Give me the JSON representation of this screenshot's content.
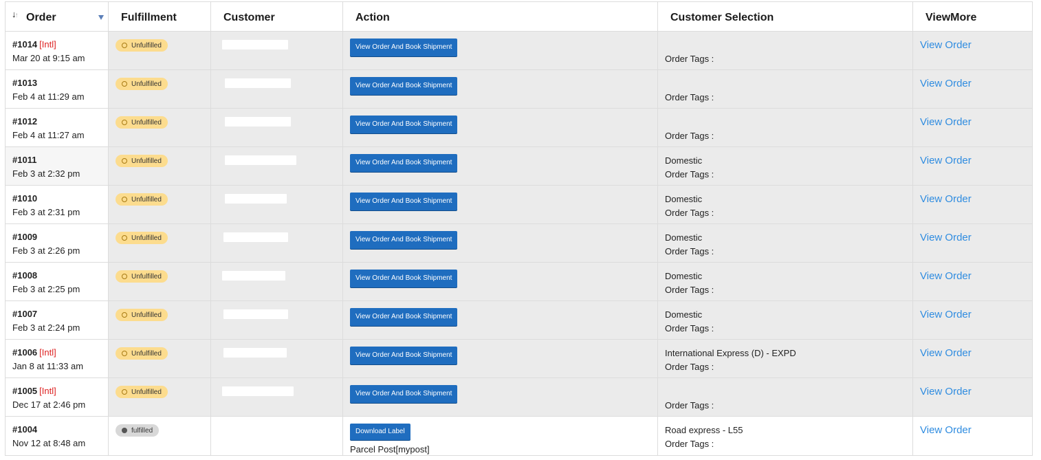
{
  "headers": {
    "order": "Order",
    "fulfillment": "Fulfillment",
    "customer": "Customer",
    "action": "Action",
    "customer_selection": "Customer Selection",
    "view_more": "ViewMore"
  },
  "icons": {
    "sort": "sort-arrows-icon",
    "filter": "filter-triangle-icon"
  },
  "colors": {
    "button": "#1f6dbf",
    "link": "#2f8ce0",
    "intl": "#dd2222",
    "unfulfilled_badge": "#fcdc8e",
    "fulfilled_badge": "#d8d8d8"
  },
  "orders": [
    {
      "number": "#1014",
      "intl": "[Intl]",
      "date": "Mar 20 at 9:15 am",
      "status": "Unfulfilled",
      "action": "View Order And Book Shipment",
      "carrier": "",
      "selection": "",
      "tags": "Order Tags :",
      "view": "View Order"
    },
    {
      "number": "#1013",
      "intl": "",
      "date": "Feb 4 at 11:29 am",
      "status": "Unfulfilled",
      "action": "View Order And Book Shipment",
      "carrier": "",
      "selection": "",
      "tags": "Order Tags :",
      "view": "View Order"
    },
    {
      "number": "#1012",
      "intl": "",
      "date": "Feb 4 at 11:27 am",
      "status": "Unfulfilled",
      "action": "View Order And Book Shipment",
      "carrier": "",
      "selection": "",
      "tags": "Order Tags :",
      "view": "View Order"
    },
    {
      "number": "#1011",
      "intl": "",
      "date": "Feb 3 at 2:32 pm",
      "status": "Unfulfilled",
      "action": "View Order And Book Shipment",
      "carrier": "",
      "selection": "Domestic",
      "tags": "Order Tags :",
      "view": "View Order"
    },
    {
      "number": "#1010",
      "intl": "",
      "date": "Feb 3 at 2:31 pm",
      "status": "Unfulfilled",
      "action": "View Order And Book Shipment",
      "carrier": "",
      "selection": "Domestic",
      "tags": "Order Tags :",
      "view": "View Order"
    },
    {
      "number": "#1009",
      "intl": "",
      "date": "Feb 3 at 2:26 pm",
      "status": "Unfulfilled",
      "action": "View Order And Book Shipment",
      "carrier": "",
      "selection": "Domestic",
      "tags": "Order Tags :",
      "view": "View Order"
    },
    {
      "number": "#1008",
      "intl": "",
      "date": "Feb 3 at 2:25 pm",
      "status": "Unfulfilled",
      "action": "View Order And Book Shipment",
      "carrier": "",
      "selection": "Domestic",
      "tags": "Order Tags :",
      "view": "View Order"
    },
    {
      "number": "#1007",
      "intl": "",
      "date": "Feb 3 at 2:24 pm",
      "status": "Unfulfilled",
      "action": "View Order And Book Shipment",
      "carrier": "",
      "selection": "Domestic",
      "tags": "Order Tags :",
      "view": "View Order"
    },
    {
      "number": "#1006",
      "intl": "[Intl]",
      "date": "Jan 8 at 11:33 am",
      "status": "Unfulfilled",
      "action": "View Order And Book Shipment",
      "carrier": "",
      "selection": "International Express (D) - EXPD",
      "tags": "Order Tags :",
      "view": "View Order"
    },
    {
      "number": "#1005",
      "intl": "[Intl]",
      "date": "Dec 17 at 2:46 pm",
      "status": "Unfulfilled",
      "action": "View Order And Book Shipment",
      "carrier": "",
      "selection": "",
      "tags": "Order Tags :",
      "view": "View Order"
    },
    {
      "number": "#1004",
      "intl": "",
      "date": "Nov 12 at 8:48 am",
      "status": "fulfilled",
      "action": "Download Label",
      "carrier": "Parcel Post[mypost]",
      "selection": "Road express - L55",
      "tags": "Order Tags :",
      "view": "View Order"
    }
  ]
}
